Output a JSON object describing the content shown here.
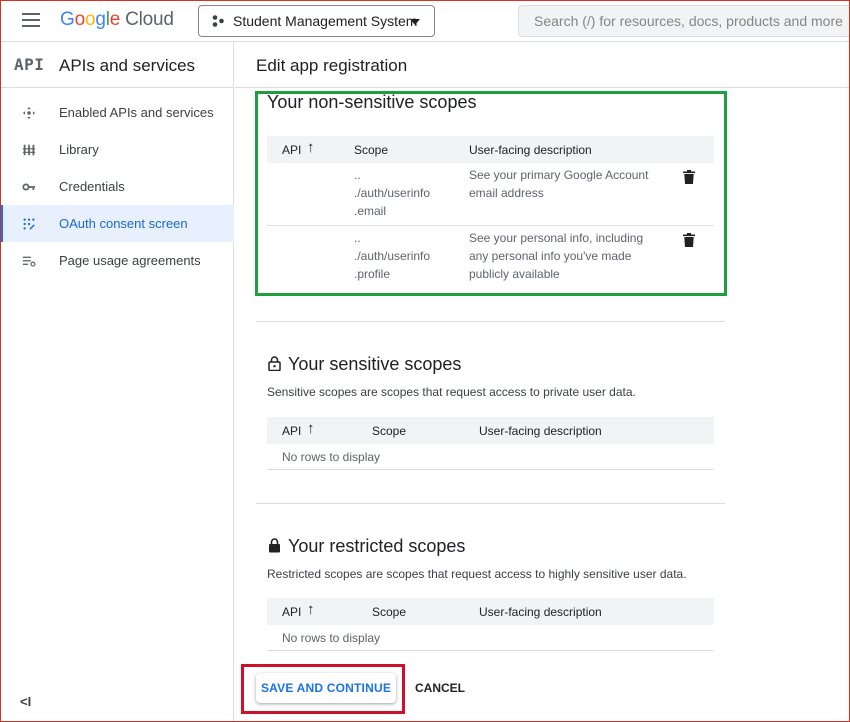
{
  "header": {
    "logo_letters": [
      "G",
      "o",
      "o",
      "g",
      "l",
      "e"
    ],
    "logo_suffix": "Cloud",
    "project_name": "Student Management System",
    "search_placeholder": "Search (/) for resources, docs, products and more"
  },
  "sidebar": {
    "badge": "API",
    "title": "APIs and services",
    "items": [
      {
        "label": "Enabled APIs and services",
        "icon": "apis-icon",
        "active": false
      },
      {
        "label": "Library",
        "icon": "library-icon",
        "active": false
      },
      {
        "label": "Credentials",
        "icon": "key-icon",
        "active": false
      },
      {
        "label": "OAuth consent screen",
        "icon": "oauth-icon",
        "active": true
      },
      {
        "label": "Page usage agreements",
        "icon": "settings-list-icon",
        "active": false
      }
    ],
    "collapse_label": "<I"
  },
  "page": {
    "title": "Edit app registration"
  },
  "non_sensitive": {
    "title": "Your non-sensitive scopes",
    "columns": [
      "API",
      "Scope",
      "User-facing description"
    ],
    "rows": [
      {
        "scope_lines": [
          "..",
          "./auth/userinfo",
          ".email"
        ],
        "description": "See your primary Google Account email address"
      },
      {
        "scope_lines": [
          "..",
          "./auth/userinfo",
          ".profile"
        ],
        "description": "See your personal info, including any personal info you've made publicly available"
      }
    ]
  },
  "sensitive": {
    "title": "Your sensitive scopes",
    "description": "Sensitive scopes are scopes that request access to private user data.",
    "columns": [
      "API",
      "Scope",
      "User-facing description"
    ],
    "empty": "No rows to display"
  },
  "restricted": {
    "title": "Your restricted scopes",
    "description": "Restricted scopes are scopes that request access to highly sensitive user data.",
    "columns": [
      "API",
      "Scope",
      "User-facing description"
    ],
    "empty": "No rows to display"
  },
  "actions": {
    "save": "SAVE AND CONTINUE",
    "cancel": "CANCEL"
  },
  "colors": {
    "accent": "#1a73e8",
    "highlight_green": "#1e9e3c",
    "highlight_red": "#d0102b"
  }
}
